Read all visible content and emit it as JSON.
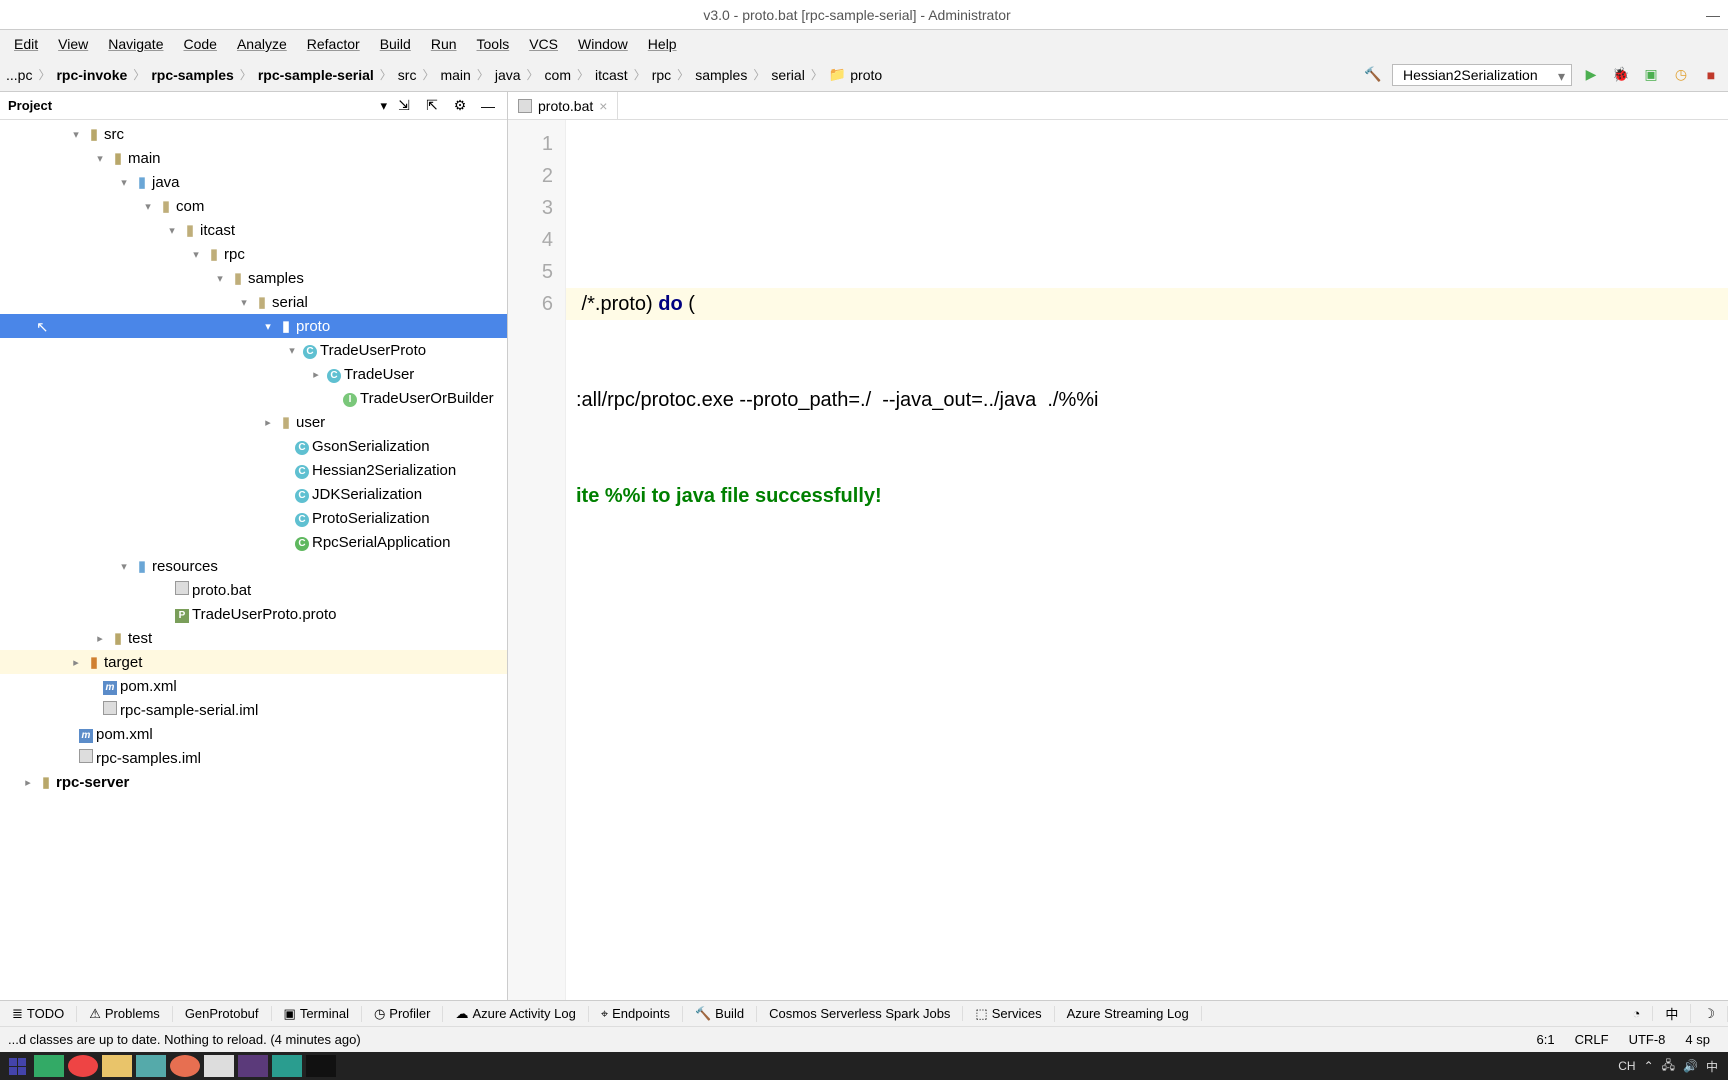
{
  "window": {
    "title": "v3.0 - proto.bat [rpc-sample-serial] - Administrator",
    "minimize": "—"
  },
  "menus": [
    "Edit",
    "View",
    "Navigate",
    "Code",
    "Analyze",
    "Refactor",
    "Build",
    "Run",
    "Tools",
    "VCS",
    "Window",
    "Help"
  ],
  "breadcrumbs": [
    "...pc",
    "rpc-invoke",
    "rpc-samples",
    "rpc-sample-serial",
    "src",
    "main",
    "java",
    "com",
    "itcast",
    "rpc",
    "samples",
    "serial",
    "proto"
  ],
  "runConfig": "Hessian2Serialization",
  "panel": {
    "title": "Project"
  },
  "tree": {
    "src": "src",
    "main": "main",
    "java": "java",
    "com": "com",
    "itcast": "itcast",
    "rpc": "rpc",
    "samples": "samples",
    "serial": "serial",
    "proto": "proto",
    "tradeUserProto": "TradeUserProto",
    "tradeUser": "TradeUser",
    "tradeUserOrBuilder": "TradeUserOrBuilder",
    "user": "user",
    "gson": "GsonSerialization",
    "hessian": "Hessian2Serialization",
    "jdk": "JDKSerialization",
    "protoSer": "ProtoSerialization",
    "rpcApp": "RpcSerialApplication",
    "resources": "resources",
    "protoBat": "proto.bat",
    "protoFile": "TradeUserProto.proto",
    "test": "test",
    "target": "target",
    "pom": "pom.xml",
    "iml1": "rpc-sample-serial.iml",
    "pom2": "pom.xml",
    "iml2": "rpc-samples.iml",
    "rpcServer": "rpc-server"
  },
  "tab": {
    "name": "proto.bat"
  },
  "gutter": [
    "1",
    "2",
    "3",
    "4",
    "5",
    "6"
  ],
  "code": {
    "l1": "",
    "l2pre": " /*.proto) ",
    "l2kw": "do",
    "l2post": " (",
    "l3": ":all/rpc/protoc.exe --proto_path=./  --java_out=../java  ./%%i",
    "l4": "ite %%i to java file successfully!",
    "l5": "",
    "l6": ""
  },
  "bottomTabs": [
    "TODO",
    "Problems",
    "GenProtobuf",
    "Terminal",
    "Profiler",
    "Azure Activity Log",
    "Endpoints",
    "Build",
    "Cosmos Serverless Spark Jobs",
    "Services",
    "Azure Streaming Log"
  ],
  "status": {
    "msg": "...d classes are up to date. Nothing to reload. (4 minutes ago)",
    "pos": "6:1",
    "lineSep": "CRLF",
    "enc": "UTF-8",
    "indent": "4 sp"
  },
  "tray": {
    "ime": "CH",
    "pin": "中"
  }
}
